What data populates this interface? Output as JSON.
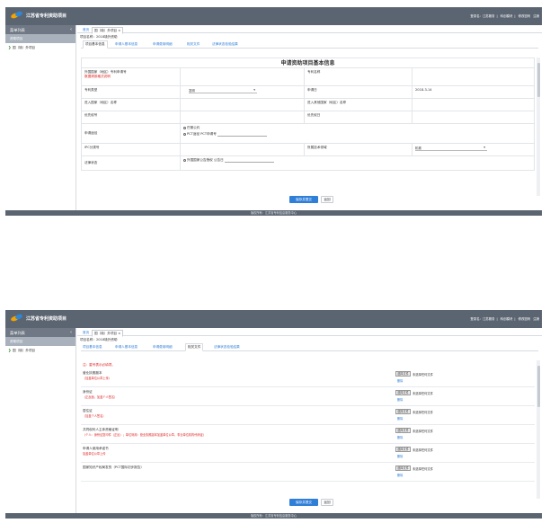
{
  "header": {
    "app_title": "江苏省专利资助项目",
    "user_items": [
      "登录名：江苏服务",
      "科创模块",
      "修改密码",
      "注销"
    ]
  },
  "sidebar": {
    "title": "菜单列表",
    "collapse_glyph": "‹",
    "group": "资助项目",
    "items": [
      {
        "label": "国（境）外项目"
      }
    ]
  },
  "page_tabs": {
    "home": "首页",
    "current": "国（境）外项目 ×"
  },
  "project_name": "项目名称：2018境外资助",
  "subtabs": [
    "项目基本信息",
    "申请人基本信息",
    "申请费用明细",
    "相关文件",
    "法律状态检验结果"
  ],
  "top_screen": {
    "form_title": "申请资助项目基本信息",
    "rows": [
      {
        "l1": "外国国家（地区）专利申请号",
        "l1_note": "数据请按格式说明",
        "l2": "",
        "l3": "专利名称",
        "l4": ""
      },
      {
        "l1": "专利类型",
        "select": "发明",
        "l3": "申请日",
        "l4": "2018-3-14"
      },
      {
        "l1": "进入国家（地区）名称",
        "l2": "",
        "l3": "进入其他国家（地区）名称",
        "l4": ""
      },
      {
        "l1": "优先权号",
        "l2": "",
        "l3": "优先权日",
        "l4": ""
      },
      {
        "l1": "申请途径",
        "opt1": "巴黎公约",
        "opt2": "PCT途径",
        "pct_label": "PCT申请号"
      },
      {
        "l1": "IPC分类号",
        "l2": "",
        "l3": "所属技术领域",
        "select2": "机械"
      },
      {
        "l1": "法律状态",
        "opt3": "外国国家公告授权",
        "pub_label": "公告日"
      }
    ]
  },
  "bottom_screen": {
    "note": "注：星号表示必填项。",
    "attachments": [
      {
        "label": "营业执照副本",
        "hint": "（加盖单位公章上传）"
      },
      {
        "label": "身份证",
        "hint": "（正反面，加盖个人签名）"
      },
      {
        "label": "居住证",
        "hint": "（加盖个人签名）"
      },
      {
        "label": "共同权利人主体资格证明",
        "hint": "（个人：身份证复印件（正反）；单位利用：营业执照副本加盖单位公章，事业单位机构代码证）"
      },
      {
        "label": "申请人使用承诺书",
        "hint": "加盖单位公章上传"
      },
      {
        "label": "国家知识产权局发的（PCT国际初步报告）",
        "hint": ""
      }
    ],
    "choose_btn": "选择文件",
    "no_file": "未选择任何文件",
    "clear": "删除"
  },
  "actions": {
    "save": "保存并提交",
    "back": "返回"
  },
  "footer": "版权所有：江苏省专利信息服务中心"
}
